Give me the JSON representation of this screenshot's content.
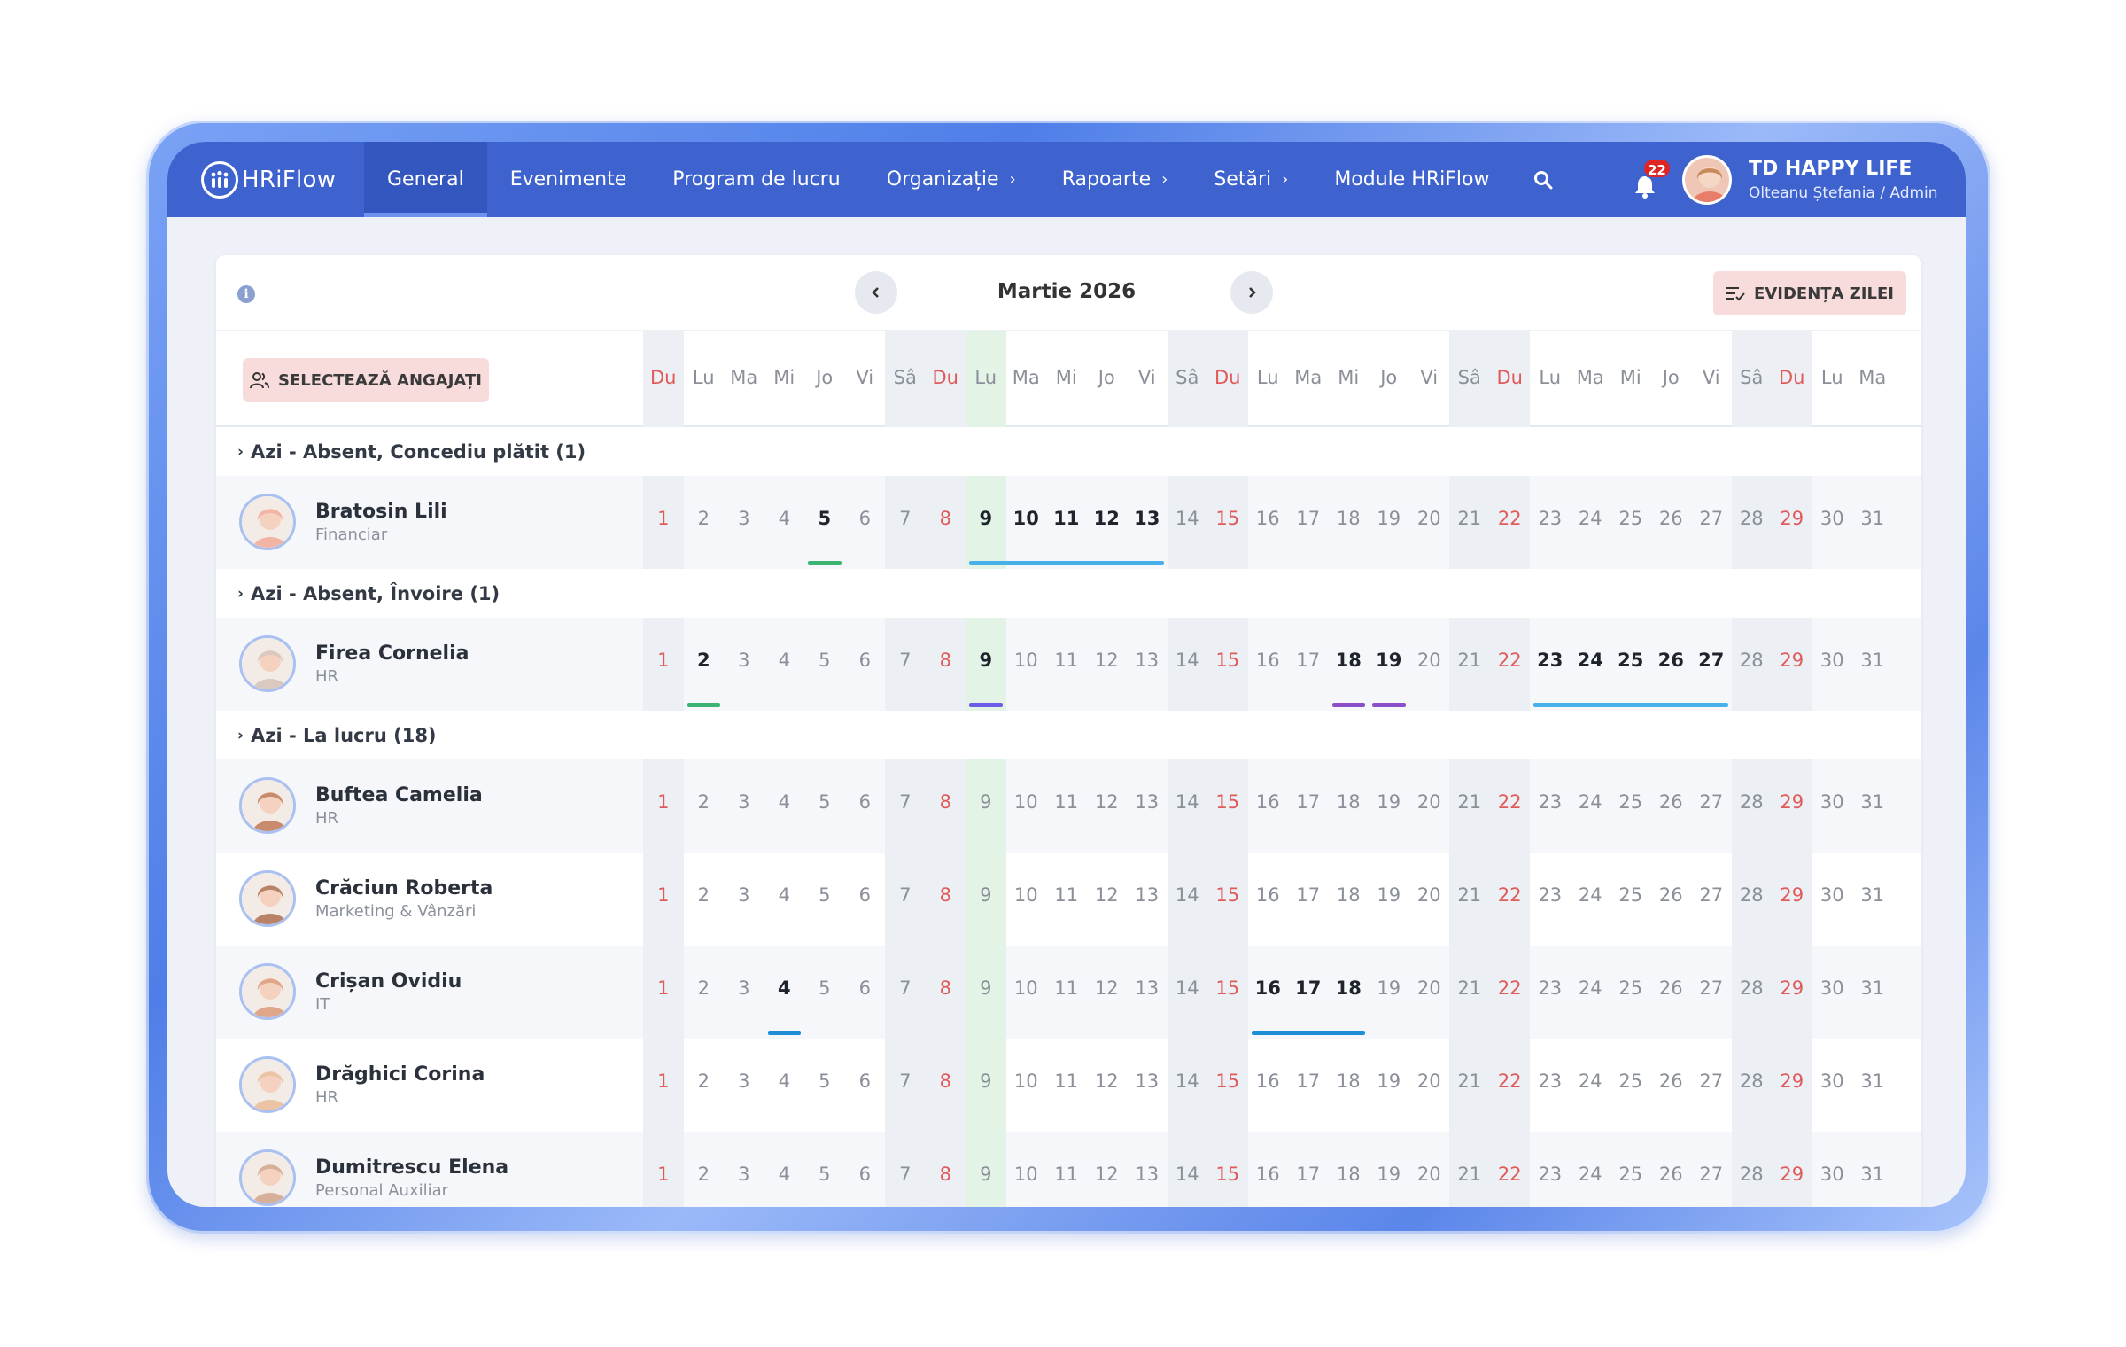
{
  "app": {
    "logo_text": "HRiFlow"
  },
  "nav": {
    "items": [
      {
        "label": "General",
        "active": true,
        "dropdown": false
      },
      {
        "label": "Evenimente",
        "active": false,
        "dropdown": false
      },
      {
        "label": "Program de lucru",
        "active": false,
        "dropdown": false
      },
      {
        "label": "Organizație",
        "active": false,
        "dropdown": true
      },
      {
        "label": "Rapoarte",
        "active": false,
        "dropdown": true
      },
      {
        "label": "Setări",
        "active": false,
        "dropdown": true
      },
      {
        "label": "Module HRiFlow",
        "active": false,
        "dropdown": false
      }
    ],
    "notifications_count": "22",
    "org_name": "TD HAPPY LIFE",
    "user_role": "Olteanu Ștefania / Admin"
  },
  "calendar": {
    "month_title": "Martie 2026",
    "evidenta_label": "EVIDENȚA ZILEI",
    "select_label": "SELECTEAZĂ ANGAJAȚI",
    "weekdays": [
      "Du",
      "Lu",
      "Ma",
      "Mi",
      "Jo",
      "Vi",
      "Sâ",
      "Du",
      "Lu",
      "Ma",
      "Mi",
      "Jo",
      "Vi",
      "Sâ",
      "Du",
      "Lu",
      "Ma",
      "Mi",
      "Jo",
      "Vi",
      "Sâ",
      "Du",
      "Lu",
      "Ma",
      "Mi",
      "Jo",
      "Vi",
      "Sâ",
      "Du",
      "Lu",
      "Ma"
    ],
    "sundays": [
      1,
      8,
      15,
      22,
      29
    ],
    "saturdays": [
      7,
      14,
      21,
      28
    ],
    "today": 9,
    "colors": {
      "accent": "#3e63cf",
      "sunday": "#e05a5a",
      "today_column": "#e3f3e6",
      "weekend_column": "#eceff3",
      "marker_green": "#3cb371",
      "marker_blue": "#4ab0e8",
      "marker_purple": "#8b4fc9",
      "marker_indigo": "#6c5ce7",
      "marker_darkblue": "#1e8fd6"
    }
  },
  "groups": [
    {
      "label": "Azi - Absent, Concediu plătit (1)",
      "employees": [
        {
          "name": "Bratosin Lili",
          "dept": "Financiar",
          "avatar_color": "#f2b5a3",
          "bold_days": [
            5,
            9,
            10,
            11,
            12,
            13
          ],
          "marks": [
            {
              "from": 5,
              "to": 5,
              "color": "#3cb371"
            },
            {
              "from": 9,
              "to": 13,
              "color": "#4ab0e8"
            }
          ]
        }
      ]
    },
    {
      "label": "Azi - Absent, Învoire (1)",
      "employees": [
        {
          "name": "Firea Cornelia",
          "dept": "HR",
          "avatar_color": "#d9c9bf",
          "bold_days": [
            2,
            9,
            18,
            19,
            23,
            24,
            25,
            26,
            27
          ],
          "marks": [
            {
              "from": 2,
              "to": 2,
              "color": "#3cb371"
            },
            {
              "from": 9,
              "to": 9,
              "color": "#6c5ce7"
            },
            {
              "from": 18,
              "to": 18,
              "color": "#8b4fc9"
            },
            {
              "from": 19,
              "to": 19,
              "color": "#8b4fc9"
            },
            {
              "from": 23,
              "to": 27,
              "color": "#4ab0e8"
            }
          ]
        }
      ]
    },
    {
      "label": "Azi - La lucru (18)",
      "employees": [
        {
          "name": "Buftea Camelia",
          "dept": "HR",
          "avatar_color": "#c98b6e",
          "bold_days": [],
          "marks": []
        },
        {
          "name": "Crăciun Roberta",
          "dept": "Marketing & Vânzări",
          "avatar_color": "#b9836a",
          "bold_days": [],
          "marks": []
        },
        {
          "name": "Crișan Ovidiu",
          "dept": "IT",
          "avatar_color": "#e0a68a",
          "bold_days": [
            4,
            16,
            17,
            18
          ],
          "marks": [
            {
              "from": 4,
              "to": 4,
              "color": "#1e8fd6"
            },
            {
              "from": 16,
              "to": 18,
              "color": "#1e8fd6"
            }
          ]
        },
        {
          "name": "Drăghici Corina",
          "dept": "HR",
          "avatar_color": "#eac4a4",
          "bold_days": [],
          "marks": []
        },
        {
          "name": "Dumitrescu Elena",
          "dept": "Personal Auxiliar",
          "avatar_color": "#d7b09a",
          "bold_days": [],
          "marks": []
        }
      ]
    }
  ]
}
